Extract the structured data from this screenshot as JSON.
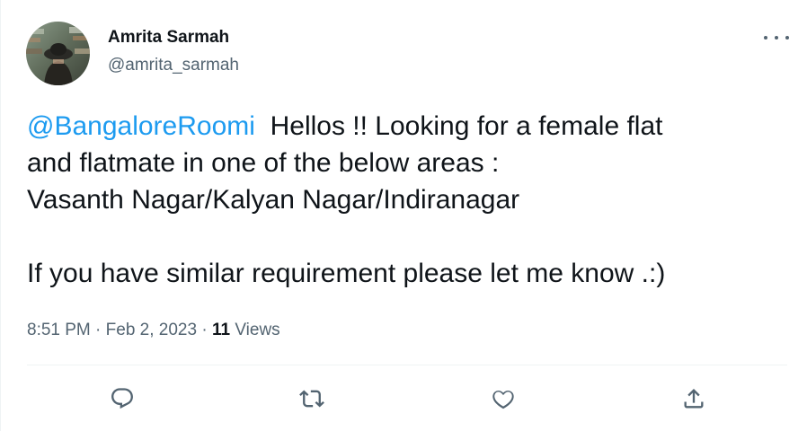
{
  "author": {
    "display_name": "Amrita Sarmah",
    "handle": "@amrita_sarmah",
    "avatar_icon": "avatar-photo"
  },
  "tweet": {
    "mention": "@BangaloreRoomi",
    "line1_rest": "  Hellos !! Looking for a female flat",
    "line2": "and flatmate in one of the below areas :",
    "line3": "Vasanth Nagar/Kalyan Nagar/Indiranagar",
    "line4": "",
    "line5": "If you have similar requirement please let me know .:)"
  },
  "meta": {
    "time": "8:51 PM",
    "separator": "·",
    "date": "Feb 2, 2023",
    "views_count": "11",
    "views_label": "Views"
  },
  "actions": {
    "reply_icon": "reply-icon",
    "retweet_icon": "retweet-icon",
    "like_icon": "like-icon",
    "share_icon": "share-icon"
  },
  "colors": {
    "accent": "#1d9bf0",
    "text": "#0f1419",
    "secondary": "#536471",
    "divider": "#eff3f4"
  }
}
